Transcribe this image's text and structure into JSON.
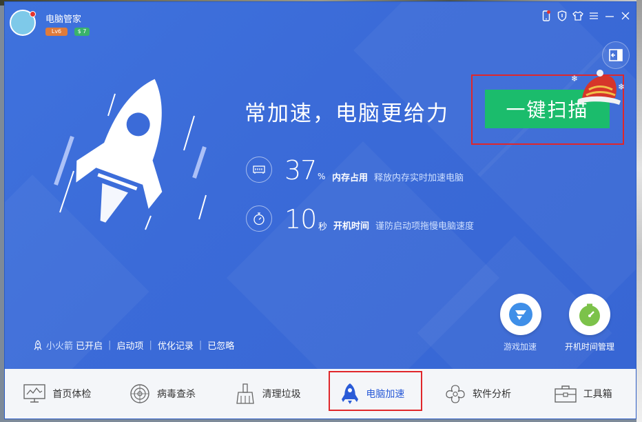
{
  "app": {
    "title": "电脑管家",
    "level_badge": "Lv6",
    "vip_badge": "$ 7"
  },
  "window_controls": [
    "phone-icon",
    "shield-icon",
    "skin-icon",
    "menu-icon",
    "minimize-icon",
    "close-icon"
  ],
  "hero": {
    "headline": "常加速，电脑更给力",
    "scan_button": "一键扫描",
    "stats": [
      {
        "icon": "memory-chip-icon",
        "value": "37",
        "unit": "%",
        "label": "内存占用",
        "desc": "释放内存实时加速电脑"
      },
      {
        "icon": "stopwatch-icon",
        "value": "10",
        "unit": "秒",
        "label": "开机时间",
        "desc": "谨防启动项拖慢电脑速度"
      }
    ],
    "quick_actions": [
      {
        "icon": "game-boost-icon",
        "label": "游戏加速"
      },
      {
        "icon": "boot-time-icon",
        "label": "开机时间管理"
      }
    ],
    "rocket_status": {
      "name": "小火箭",
      "state": "已开启",
      "links": [
        "启动项",
        "优化记录",
        "已忽略"
      ]
    }
  },
  "nav": [
    {
      "icon": "monitor-icon",
      "label": "首页体检",
      "active": false
    },
    {
      "icon": "radar-icon",
      "label": "病毒查杀",
      "active": false
    },
    {
      "icon": "broom-icon",
      "label": "清理垃圾",
      "active": false
    },
    {
      "icon": "rocket-icon",
      "label": "电脑加速",
      "active": true
    },
    {
      "icon": "software-icon",
      "label": "软件分析",
      "active": false
    },
    {
      "icon": "toolbox-icon",
      "label": "工具箱",
      "active": false
    }
  ],
  "colors": {
    "primary": "#3a6fd8",
    "scan_green": "#1bbc6c",
    "highlight_red": "#e0262a",
    "active_nav": "#2a5bd7"
  }
}
